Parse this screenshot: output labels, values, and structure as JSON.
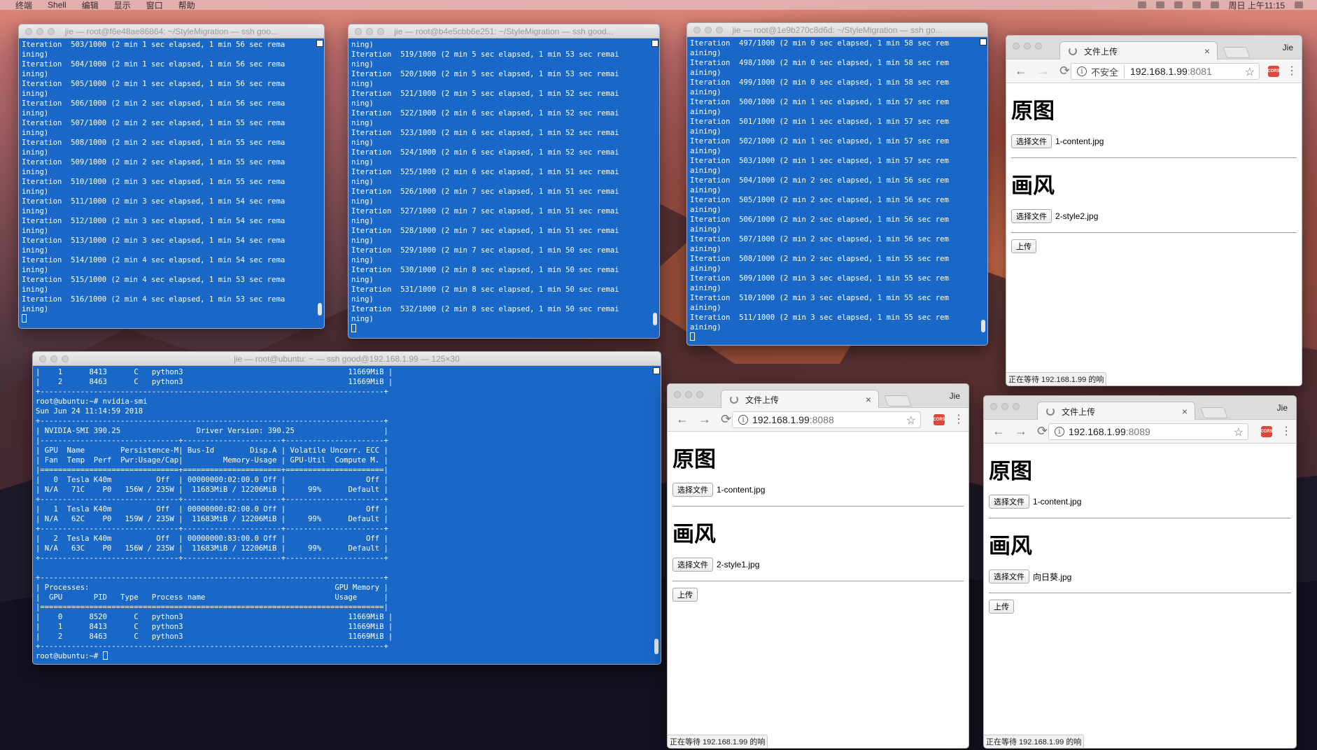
{
  "menubar": {
    "items": [
      "终端",
      "Shell",
      "编辑",
      "显示",
      "窗口",
      "帮助"
    ],
    "clock": "周日 上午11:15"
  },
  "term1": {
    "title": "jie — root@f6e48ae86864: ~/StyleMigration — ssh goo...",
    "text": "Iteration  503/1000 (2 min 1 sec elapsed, 1 min 56 sec rema\nining)\nIteration  504/1000 (2 min 1 sec elapsed, 1 min 56 sec rema\nining)\nIteration  505/1000 (2 min 1 sec elapsed, 1 min 56 sec rema\nining)\nIteration  506/1000 (2 min 2 sec elapsed, 1 min 56 sec rema\nining)\nIteration  507/1000 (2 min 2 sec elapsed, 1 min 55 sec rema\nining)\nIteration  508/1000 (2 min 2 sec elapsed, 1 min 55 sec rema\nining)\nIteration  509/1000 (2 min 2 sec elapsed, 1 min 55 sec rema\nining)\nIteration  510/1000 (2 min 3 sec elapsed, 1 min 55 sec rema\nining)\nIteration  511/1000 (2 min 3 sec elapsed, 1 min 54 sec rema\nining)\nIteration  512/1000 (2 min 3 sec elapsed, 1 min 54 sec rema\nining)\nIteration  513/1000 (2 min 3 sec elapsed, 1 min 54 sec rema\nining)\nIteration  514/1000 (2 min 4 sec elapsed, 1 min 54 sec rema\nining)\nIteration  515/1000 (2 min 4 sec elapsed, 1 min 53 sec rema\nining)\nIteration  516/1000 (2 min 4 sec elapsed, 1 min 53 sec rema\nining)"
  },
  "term2": {
    "title": "jie — root@b4e5cbb6e251: ~/StyleMigration — ssh good...",
    "text": "ning)\nIteration  519/1000 (2 min 5 sec elapsed, 1 min 53 sec remai\nning)\nIteration  520/1000 (2 min 5 sec elapsed, 1 min 53 sec remai\nning)\nIteration  521/1000 (2 min 5 sec elapsed, 1 min 52 sec remai\nning)\nIteration  522/1000 (2 min 6 sec elapsed, 1 min 52 sec remai\nning)\nIteration  523/1000 (2 min 6 sec elapsed, 1 min 52 sec remai\nning)\nIteration  524/1000 (2 min 6 sec elapsed, 1 min 52 sec remai\nning)\nIteration  525/1000 (2 min 6 sec elapsed, 1 min 51 sec remai\nning)\nIteration  526/1000 (2 min 7 sec elapsed, 1 min 51 sec remai\nning)\nIteration  527/1000 (2 min 7 sec elapsed, 1 min 51 sec remai\nning)\nIteration  528/1000 (2 min 7 sec elapsed, 1 min 51 sec remai\nning)\nIteration  529/1000 (2 min 7 sec elapsed, 1 min 50 sec remai\nning)\nIteration  530/1000 (2 min 8 sec elapsed, 1 min 50 sec remai\nning)\nIteration  531/1000 (2 min 8 sec elapsed, 1 min 50 sec remai\nning)\nIteration  532/1000 (2 min 8 sec elapsed, 1 min 50 sec remai\nning)"
  },
  "term3": {
    "title": "jie — root@1e9b270c8d6d: ~/StyleMigration — ssh go...",
    "text": "Iteration  497/1000 (2 min 0 sec elapsed, 1 min 58 sec rem\naining)\nIteration  498/1000 (2 min 0 sec elapsed, 1 min 58 sec rem\naining)\nIteration  499/1000 (2 min 0 sec elapsed, 1 min 58 sec rem\naining)\nIteration  500/1000 (2 min 1 sec elapsed, 1 min 57 sec rem\naining)\nIteration  501/1000 (2 min 1 sec elapsed, 1 min 57 sec rem\naining)\nIteration  502/1000 (2 min 1 sec elapsed, 1 min 57 sec rem\naining)\nIteration  503/1000 (2 min 1 sec elapsed, 1 min 57 sec rem\naining)\nIteration  504/1000 (2 min 2 sec elapsed, 1 min 56 sec rem\naining)\nIteration  505/1000 (2 min 2 sec elapsed, 1 min 56 sec rem\naining)\nIteration  506/1000 (2 min 2 sec elapsed, 1 min 56 sec rem\naining)\nIteration  507/1000 (2 min 2 sec elapsed, 1 min 56 sec rem\naining)\nIteration  508/1000 (2 min 2 sec elapsed, 1 min 55 sec rem\naining)\nIteration  509/1000 (2 min 3 sec elapsed, 1 min 55 sec rem\naining)\nIteration  510/1000 (2 min 3 sec elapsed, 1 min 55 sec rem\naining)\nIteration  511/1000 (2 min 3 sec elapsed, 1 min 55 sec rem\naining)"
  },
  "term4": {
    "title": "jie — root@ubuntu: ~ — ssh good@192.168.1.99 — 125×30",
    "text": "|    1      8413      C   python3                                     11669MiB |\n|    2      8463      C   python3                                     11669MiB |\n+-----------------------------------------------------------------------------+\nroot@ubuntu:~# nvidia-smi\nSun Jun 24 11:14:59 2018\n+-----------------------------------------------------------------------------+\n| NVIDIA-SMI 390.25                 Driver Version: 390.25                    |\n|-------------------------------+----------------------+----------------------+\n| GPU  Name        Persistence-M| Bus-Id        Disp.A | Volatile Uncorr. ECC |\n| Fan  Temp  Perf  Pwr:Usage/Cap|         Memory-Usage | GPU-Util  Compute M. |\n|===============================+======================+======================|\n|   0  Tesla K40m          Off  | 00000000:02:00.0 Off |                  Off |\n| N/A   71C    P0   156W / 235W |  11683MiB / 12206MiB |     99%      Default |\n+-------------------------------+----------------------+----------------------+\n|   1  Tesla K40m          Off  | 00000000:82:00.0 Off |                  Off |\n| N/A   62C    P0   159W / 235W |  11683MiB / 12206MiB |     99%      Default |\n+-------------------------------+----------------------+----------------------+\n|   2  Tesla K40m          Off  | 00000000:83:00.0 Off |                  Off |\n| N/A   63C    P0   156W / 235W |  11683MiB / 12206MiB |     99%      Default |\n+-------------------------------+----------------------+----------------------+\n\n+-----------------------------------------------------------------------------+\n| Processes:                                                       GPU Memory |\n|  GPU       PID   Type   Process name                             Usage      |\n|=============================================================================|\n|    0      8520      C   python3                                     11669MiB |\n|    1      8413      C   python3                                     11669MiB |\n|    2      8463      C   python3                                     11669MiB |\n+-----------------------------------------------------------------------------+",
    "prompt": "root@ubuntu:~# "
  },
  "browsers": {
    "b1": {
      "tab_title": "文件上传",
      "profile": "Jie",
      "insecure_label": "不安全",
      "host": "192.168.1.99",
      "port": ":8081",
      "heading1": "原图",
      "button": "选择文件",
      "file1": "1-content.jpg",
      "heading2": "画风",
      "file2": "2-style2.jpg",
      "upload": "上传",
      "status": "正在等待 192.168.1.99 的响"
    },
    "b2": {
      "tab_title": "文件上传",
      "profile": "Jie",
      "host": "192.168.1.99",
      "port": ":8088",
      "heading1": "原图",
      "button": "选择文件",
      "file1": "1-content.jpg",
      "heading2": "画风",
      "file2": "2-style1.jpg",
      "upload": "上传",
      "status": "正在等待 192.168.1.99 的响"
    },
    "b3": {
      "tab_title": "文件上传",
      "profile": "Jie",
      "host": "192.168.1.99",
      "port": ":8089",
      "heading1": "原图",
      "button": "选择文件",
      "file1": "1-content.jpg",
      "heading2": "画风",
      "file2": "向日葵.jpg",
      "upload": "上传",
      "status": "正在等待 192.168.1.99 的响"
    }
  }
}
